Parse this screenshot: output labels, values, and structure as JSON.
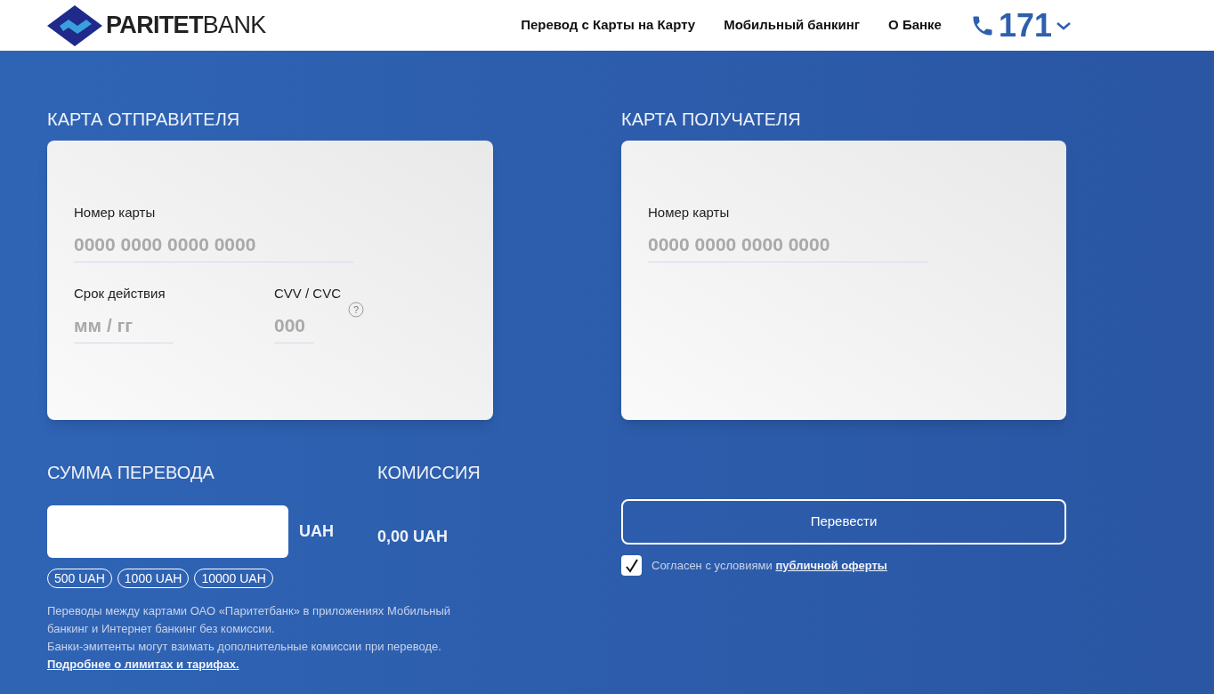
{
  "header": {
    "logo": {
      "bold": "PARITET",
      "light": "BANK"
    },
    "nav": [
      "Перевод с Карты на Карту",
      "Мобильный банкинг",
      "О Банке"
    ],
    "phone": "171"
  },
  "sender": {
    "title": "КАРТА ОТПРАВИТЕЛЯ",
    "card_number": {
      "label": "Номер карты",
      "placeholder": "0000 0000 0000 0000"
    },
    "expiry": {
      "label": "Срок действия",
      "placeholder": "мм / гг"
    },
    "cvv": {
      "label": "CVV / CVC",
      "placeholder": "000",
      "help": "?"
    }
  },
  "recipient": {
    "title": "КАРТА ПОЛУЧАТЕЛЯ",
    "card_number": {
      "label": "Номер карты",
      "placeholder": "0000 0000 0000 0000"
    }
  },
  "amount": {
    "title": "СУММА ПЕРЕВОДА",
    "currency": "UAH",
    "presets": [
      "500 UAH",
      "1000 UAH",
      "10000 UAH"
    ]
  },
  "commission": {
    "title": "КОМИССИЯ",
    "value": "0,00 UAH"
  },
  "notes": [
    "Переводы между картами ОАО «Паритетбанк» в приложениях Мобильный банкинг и Интернет банкинг без комиссии.",
    "Банки-эмитенты могут взимать дополнительные комиссии при переводе."
  ],
  "limits_link": "Подробнее о лимитах и тарифах.",
  "submit": "Перевести",
  "agreement": {
    "checked": true,
    "text": "Согласен с условиями",
    "link": "публичной оферты"
  }
}
